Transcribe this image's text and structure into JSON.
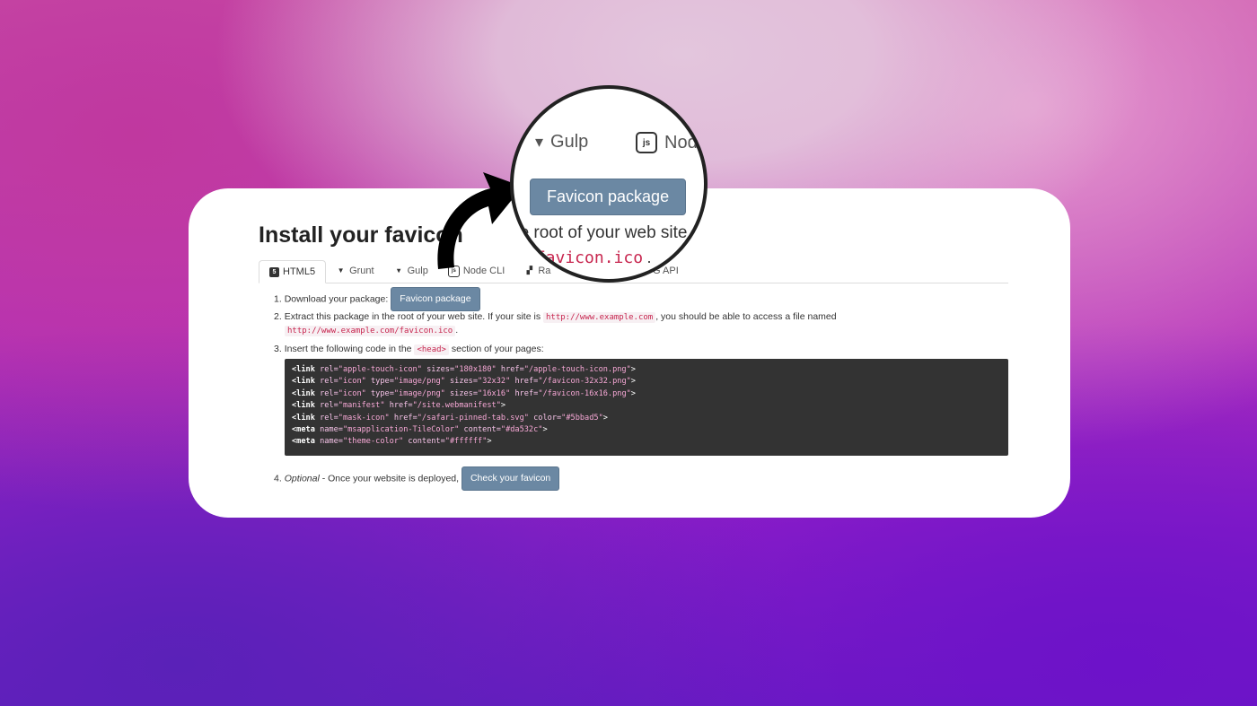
{
  "page": {
    "title": "Install your favicon",
    "tabs": [
      {
        "label": "HTML5",
        "icon": "html5-icon",
        "glyph": "5"
      },
      {
        "label": "Grunt",
        "icon": "grunt-icon",
        "glyph": "▼"
      },
      {
        "label": "Gulp",
        "icon": "gulp-icon",
        "glyph": "▾"
      },
      {
        "label": "Node CLI",
        "icon": "nodejs-icon",
        "glyph": "js"
      },
      {
        "label": "Ra",
        "icon": "rails-icon",
        "glyph": "▞"
      },
      {
        "label": "RFG API",
        "icon": "api-icon",
        "glyph": "⚙"
      }
    ],
    "steps": {
      "s1": {
        "num": "1.",
        "text": "Download your package:",
        "button": "Favicon package"
      },
      "s2": {
        "num": "2.",
        "text_a": "Extract this package in the root of your web site. If your site is",
        "code_a": "http://www.example.com",
        "text_b": ", you should be able to access a file named",
        "code_b": "http://www.example.com/favicon.ico",
        "text_c": "."
      },
      "s3": {
        "num": "3.",
        "text_a": "Insert the following code in the",
        "code": "<head>",
        "text_b": "section of your pages:"
      },
      "s4": {
        "num": "4.",
        "optional": "Optional",
        "text": " - Once your website is deployed,",
        "button": "Check your favicon"
      }
    },
    "code_lines": [
      {
        "tag": "<link",
        "parts": [
          [
            "rel=",
            "\"apple-touch-icon\""
          ],
          [
            "sizes=",
            "\"180x180\""
          ],
          [
            "href=",
            "\"/apple-touch-icon.png\""
          ]
        ]
      },
      {
        "tag": "<link",
        "parts": [
          [
            "rel=",
            "\"icon\""
          ],
          [
            "type=",
            "\"image/png\""
          ],
          [
            "sizes=",
            "\"32x32\""
          ],
          [
            "href=",
            "\"/favicon-32x32.png\""
          ]
        ]
      },
      {
        "tag": "<link",
        "parts": [
          [
            "rel=",
            "\"icon\""
          ],
          [
            "type=",
            "\"image/png\""
          ],
          [
            "sizes=",
            "\"16x16\""
          ],
          [
            "href=",
            "\"/favicon-16x16.png\""
          ]
        ]
      },
      {
        "tag": "<link",
        "parts": [
          [
            "rel=",
            "\"manifest\""
          ],
          [
            "href=",
            "\"/site.webmanifest\""
          ]
        ]
      },
      {
        "tag": "<link",
        "parts": [
          [
            "rel=",
            "\"mask-icon\""
          ],
          [
            "href=",
            "\"/safari-pinned-tab.svg\""
          ],
          [
            "color=",
            "\"#5bbad5\""
          ]
        ]
      },
      {
        "tag": "<meta",
        "parts": [
          [
            "name=",
            "\"msapplication-TileColor\""
          ],
          [
            "content=",
            "\"#da532c\""
          ]
        ]
      },
      {
        "tag": "<meta",
        "parts": [
          [
            "name=",
            "\"theme-color\""
          ],
          [
            "content=",
            "\"#ffffff\""
          ]
        ]
      }
    ]
  },
  "magnifier": {
    "tab_gulp": "Gulp",
    "tab_node": "Node",
    "button": "Favicon package",
    "text": "he root of your web site",
    "code": "/favicon.ico",
    "code_suffix": "."
  },
  "colors": {
    "button": "#6b88a3",
    "code_bg": "#333333",
    "inline_code": "#c7254e"
  }
}
